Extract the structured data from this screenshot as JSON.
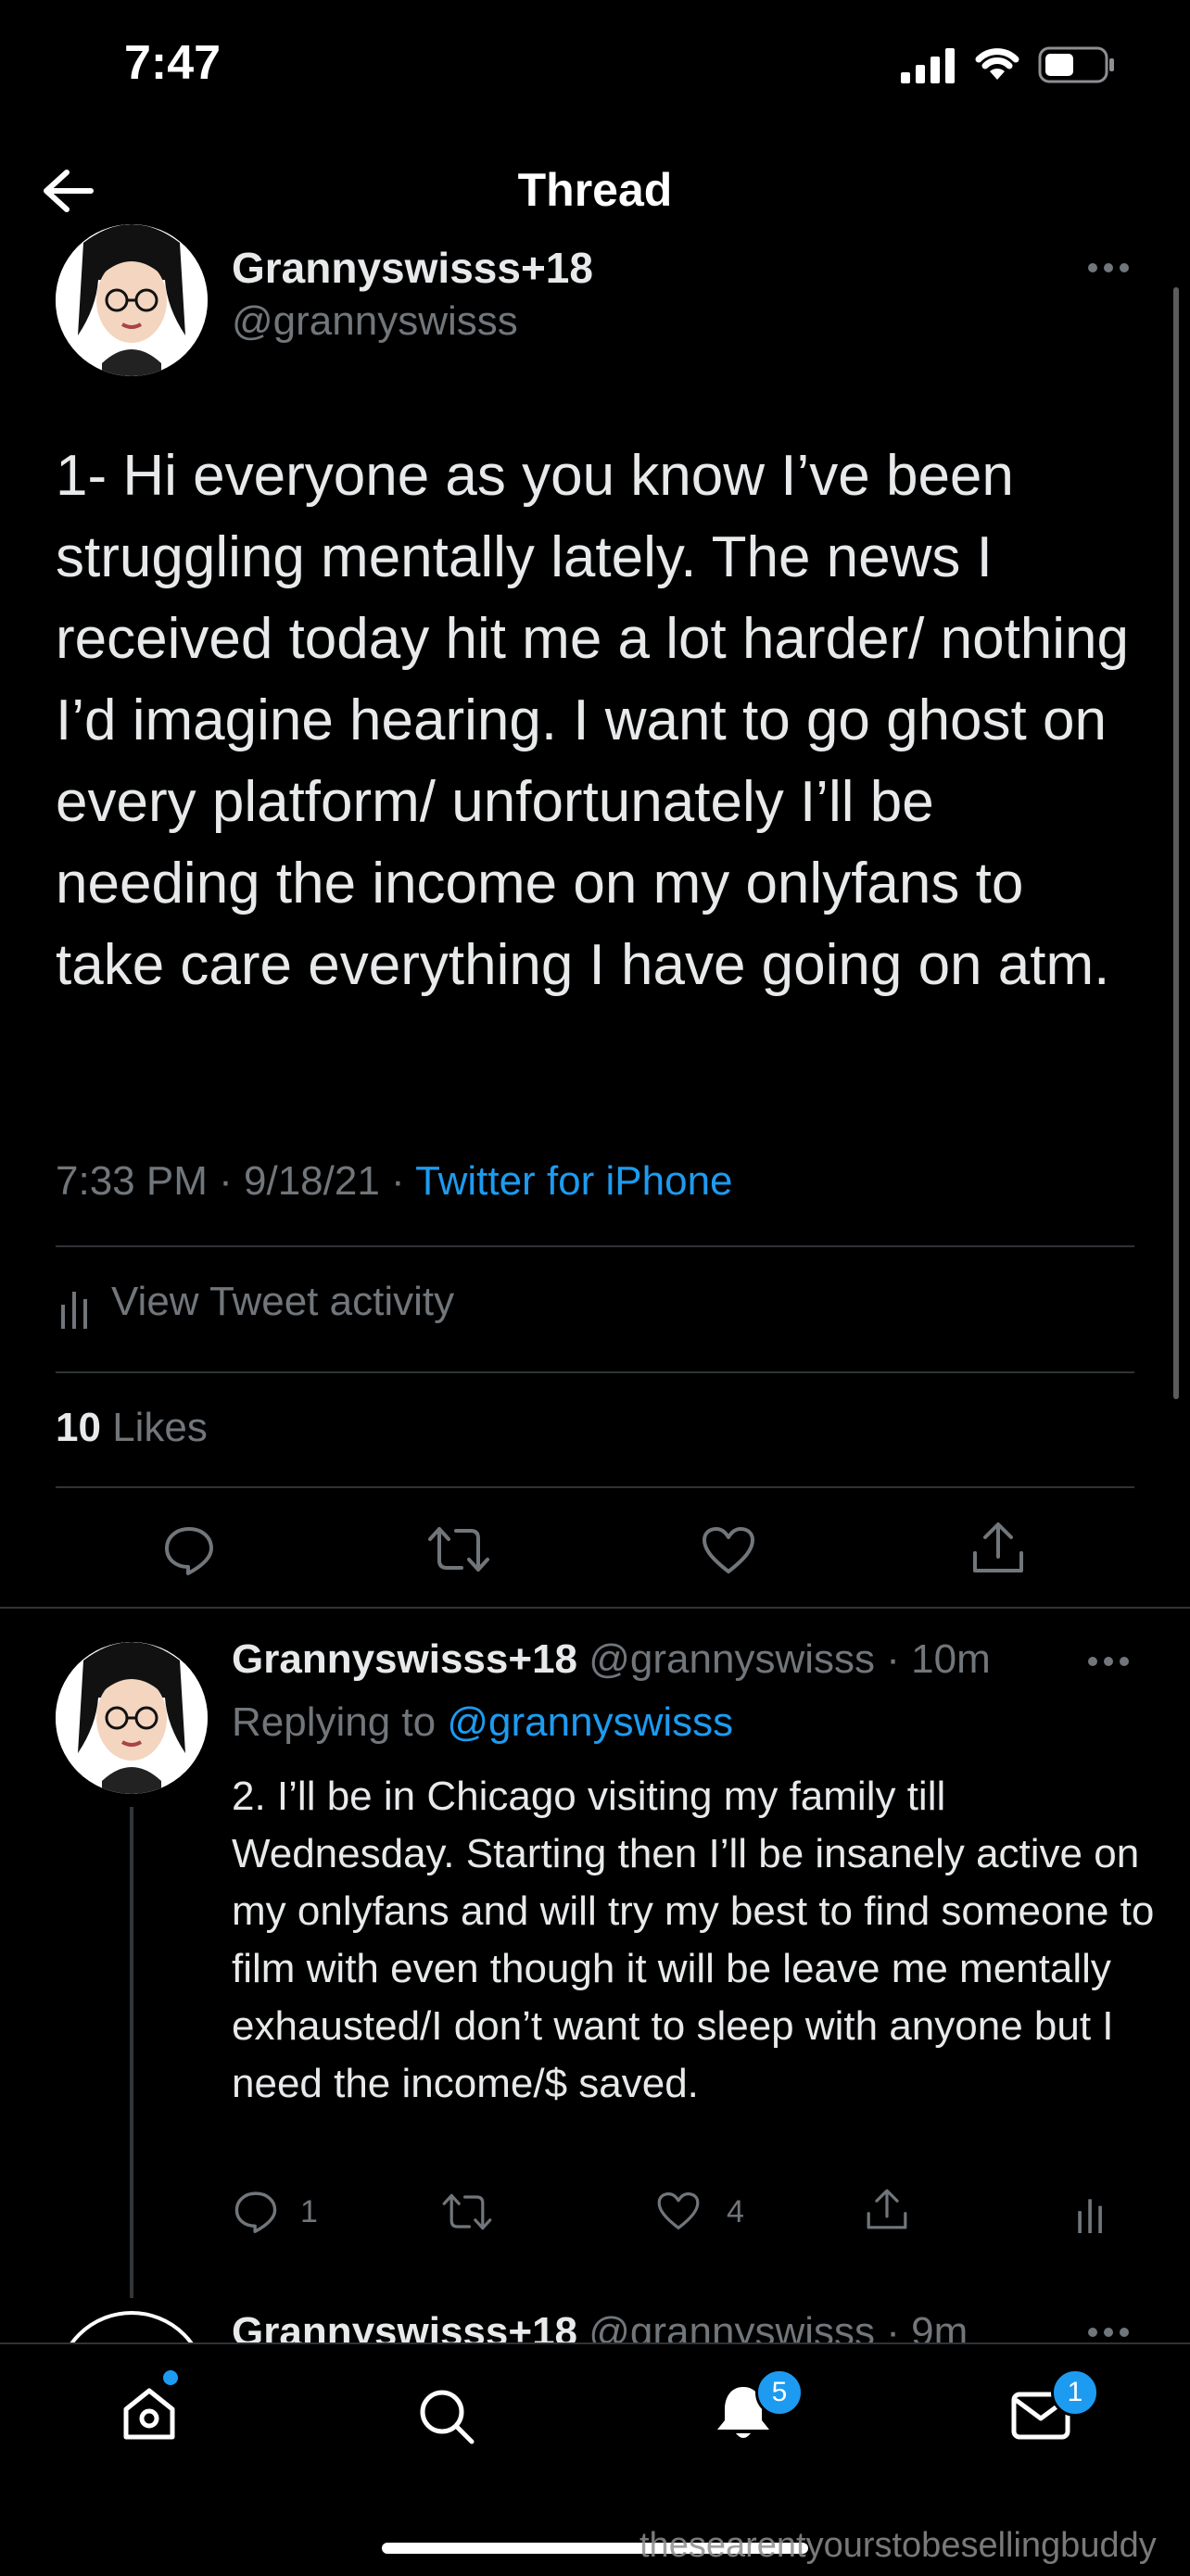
{
  "status_bar": {
    "time": "7:47"
  },
  "header": {
    "title": "Thread"
  },
  "main_tweet": {
    "display_name": "Grannyswisss+18",
    "handle": "@grannyswisss",
    "text": "1- Hi everyone as you know I’ve been struggling mentally lately. The news I received today hit me a lot harder/ nothing I’d imagine hearing. I want to go ghost on every platform/ unfortunately I’ll be needing the income on my onlyfans to take care everything I have going on atm.",
    "time": "7:33 PM",
    "date": "9/18/21",
    "source": "Twitter for iPhone",
    "activity_label": "View Tweet activity",
    "likes_count": "10",
    "likes_label": "Likes"
  },
  "reply_tweet": {
    "display_name": "Grannyswisss+18",
    "handle": "@grannyswisss",
    "age": "10m",
    "replying_prefix": "Replying to",
    "replying_handle": "@grannyswisss",
    "text": "2. I’ll be in Chicago visiting my family till Wednesday. Starting then I’ll be insanely active on my onlyfans and will try my best to find someone to film with even though it will be leave me mentally exhausted/I don’t want to sleep with anyone but I need the income/$ saved.",
    "reply_count": "1",
    "like_count": "4"
  },
  "next_tweet": {
    "display_name": "Grannyswisss+18",
    "handle": "@grannyswisss",
    "age": "9m"
  },
  "tab_bar": {
    "notifications_badge": "5",
    "messages_badge": "1"
  },
  "watermark": "thesearentyourstobesellingbuddy",
  "colors": {
    "accent": "#1d9bf0",
    "background": "#000000",
    "muted": "#71767b",
    "divider": "#2f3336"
  }
}
